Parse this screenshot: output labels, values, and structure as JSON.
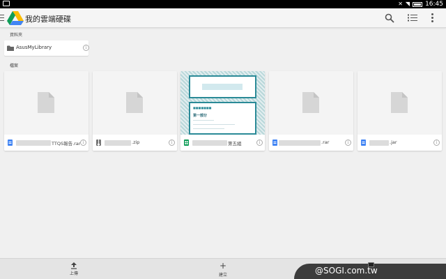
{
  "statusbar": {
    "time": "16:45"
  },
  "appbar": {
    "title": "我的雲端硬碟"
  },
  "sections": {
    "folders": "資料夾",
    "files": "檔案"
  },
  "folders": [
    {
      "name": "AsusMyLibrary"
    }
  ],
  "files": [
    {
      "name_visible": "TTQS報告.rar",
      "type": "document",
      "color": "#4285f4"
    },
    {
      "name_visible": ".zip",
      "type": "archive",
      "color": "#777777"
    },
    {
      "name_visible": "第五組",
      "type": "spreadsheet",
      "color": "#0f9d58"
    },
    {
      "name_visible": ".rar",
      "type": "document",
      "color": "#4285f4"
    },
    {
      "name_visible": ".jar",
      "type": "document",
      "color": "#4285f4"
    }
  ],
  "preview": {
    "heading": "第一部分"
  },
  "bottombar": {
    "upload_label": "上傳",
    "create_label": "建立"
  },
  "watermark": {
    "text": "@SOGI.com.tw"
  },
  "icons": [
    "menu-icon",
    "drive-logo-icon",
    "search-icon",
    "list-view-icon",
    "more-icon",
    "folder-icon",
    "info-icon",
    "file-icon",
    "upload-icon",
    "add-icon"
  ]
}
